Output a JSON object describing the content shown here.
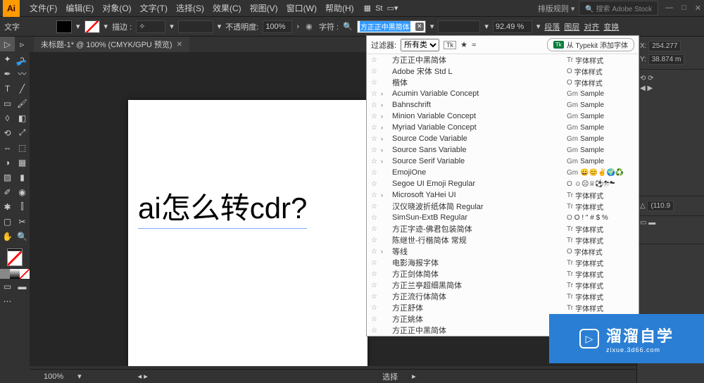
{
  "menubar": {
    "logo": "Ai",
    "items": [
      "文件(F)",
      "编辑(E)",
      "对象(O)",
      "文字(T)",
      "选择(S)",
      "效果(C)",
      "视图(V)",
      "窗口(W)",
      "帮助(H)"
    ],
    "right": {
      "layout_rules": "排版规则",
      "stock_placeholder": "搜索 Adobe Stock"
    }
  },
  "toolbar2": {
    "label_text": "文字",
    "stroke_label": "描边 :",
    "opacity_label": "不透明度:",
    "opacity_value": "100%",
    "char_label": "字符 :",
    "font_value": "方正正中黑简体",
    "zoom_value": "92.49 %",
    "right_labels": [
      "段落",
      "图层",
      "对齐",
      "变换"
    ]
  },
  "tab": {
    "title": "未标题-1* @ 100% (CMYK/GPU 预览)"
  },
  "canvas": {
    "text": "ai怎么转cdr?"
  },
  "statusbar": {
    "zoom": "100%",
    "mode": "选择"
  },
  "font_panel": {
    "filter_label": "过滤器:",
    "filter_value": "所有类",
    "typekit_label": "从 Typekit 添加字体",
    "tk_badge": "Tk",
    "rows": [
      {
        "name": "方正正中黑简体",
        "sample": "字体样式",
        "ico": "Tr"
      },
      {
        "name": "Adobe 宋体 Std L",
        "sample": "字体样式",
        "ico": "O"
      },
      {
        "name": "楷体",
        "sample": "字体样式",
        "ico": "O"
      },
      {
        "name": "Acumin Variable Concept",
        "sample": "Sample",
        "ico": "Gm",
        "chev": true
      },
      {
        "name": "Bahnschrift",
        "sample": "Sample",
        "ico": "Gm",
        "chev": true
      },
      {
        "name": "Minion Variable Concept",
        "sample": "Sample",
        "ico": "Gm",
        "chev": true
      },
      {
        "name": "Myriad Variable Concept",
        "sample": "Sample",
        "ico": "Gm",
        "chev": true
      },
      {
        "name": "Source Code Variable",
        "sample": "Sample",
        "ico": "Gm",
        "chev": true
      },
      {
        "name": "Source Sans Variable",
        "sample": "Sample",
        "ico": "Gm",
        "chev": true
      },
      {
        "name": "Source Serif Variable",
        "sample": "Sample",
        "ico": "Gm",
        "chev": true
      },
      {
        "name": "EmojiOne",
        "sample": "😀😊✌️🌍♻️",
        "ico": "Gm"
      },
      {
        "name": "Segoe UI Emoji Regular",
        "sample": "☺☹♕⚽⛈☁",
        "ico": "O"
      },
      {
        "name": "Microsoft YaHei UI",
        "sample": "字体样式",
        "ico": "Tr",
        "chev": true
      },
      {
        "name": "汉仪晓波折纸体简 Regular",
        "sample": "字体样式",
        "ico": "Tr"
      },
      {
        "name": "SimSun-ExtB Regular",
        "sample": "O ! \" # $ %",
        "ico": "O"
      },
      {
        "name": "方正字迹-佛君包装简体",
        "sample": "字体样式",
        "ico": "Tr"
      },
      {
        "name": "陈继世-行楷简体 常规",
        "sample": "字体样式",
        "ico": "Tr"
      },
      {
        "name": "等线",
        "sample": "字体样式",
        "ico": "O",
        "chev": true
      },
      {
        "name": "电影海报字体",
        "sample": "字体样式",
        "ico": "Tr"
      },
      {
        "name": "方正剑体简体",
        "sample": "字体样式",
        "ico": "Tr"
      },
      {
        "name": "方正兰亭超细黑简体",
        "sample": "字体样式",
        "ico": "Tr"
      },
      {
        "name": "方正流行体简体",
        "sample": "字体样式",
        "ico": "Tr"
      },
      {
        "name": "方正舒体",
        "sample": "字体样式",
        "ico": "Tr"
      },
      {
        "name": "方正姚体",
        "sample": "",
        "ico": ""
      },
      {
        "name": "方正正中黑简体",
        "sample": "",
        "ico": ""
      }
    ]
  },
  "right_panel": {
    "x": "254.277",
    "y": "38.874 m",
    "w": "(110.9"
  },
  "watermark": {
    "title": "溜溜自学",
    "sub": "zixue.3d66.com"
  }
}
